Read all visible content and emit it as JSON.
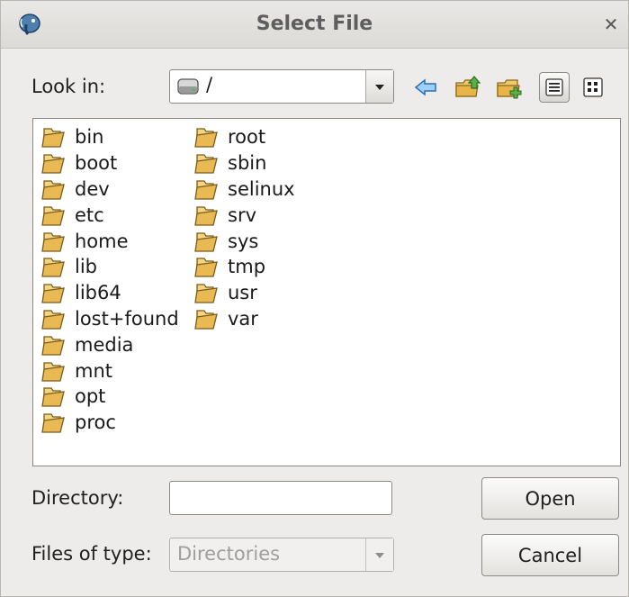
{
  "window": {
    "title": "Select File"
  },
  "lookin": {
    "label": "Look in:",
    "value": "/"
  },
  "files": {
    "col1": [
      "bin",
      "boot",
      "dev",
      "etc",
      "home",
      "lib",
      "lib64",
      "lost+found",
      "media",
      "mnt",
      "opt",
      "proc"
    ],
    "col2": [
      "root",
      "sbin",
      "selinux",
      "srv",
      "sys",
      "tmp",
      "usr",
      "var"
    ]
  },
  "directory": {
    "label": "Directory:",
    "value": ""
  },
  "filetype": {
    "label": "Files of type:",
    "value": "Directories"
  },
  "buttons": {
    "open": "Open",
    "cancel": "Cancel"
  }
}
